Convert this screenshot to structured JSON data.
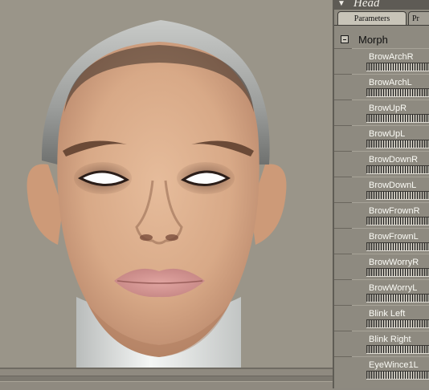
{
  "panel": {
    "title": "Head",
    "tabs": [
      {
        "label": "Parameters",
        "active": true
      },
      {
        "label": "Pr",
        "active": false
      }
    ],
    "group": {
      "label": "Morph",
      "expanded": true,
      "icon": "collapse-minus-icon"
    },
    "parameters": [
      {
        "label": "BrowArchR"
      },
      {
        "label": "BrowArchL"
      },
      {
        "label": "BrowUpR"
      },
      {
        "label": "BrowUpL"
      },
      {
        "label": "BrowDownR"
      },
      {
        "label": "BrowDownL"
      },
      {
        "label": "BrowFrownR"
      },
      {
        "label": "BrowFrownL"
      },
      {
        "label": "BrowWorryR"
      },
      {
        "label": "BrowWorryL"
      },
      {
        "label": "Blink Left"
      },
      {
        "label": "Blink Right"
      },
      {
        "label": "EyeWince1L"
      }
    ]
  },
  "colors": {
    "viewport_bg": "#9a9589",
    "panel_bg": "#8e8a80",
    "header_bg": "#5e5b55",
    "label_text": "#fbfbf5",
    "skin": "#d9ac8a"
  }
}
